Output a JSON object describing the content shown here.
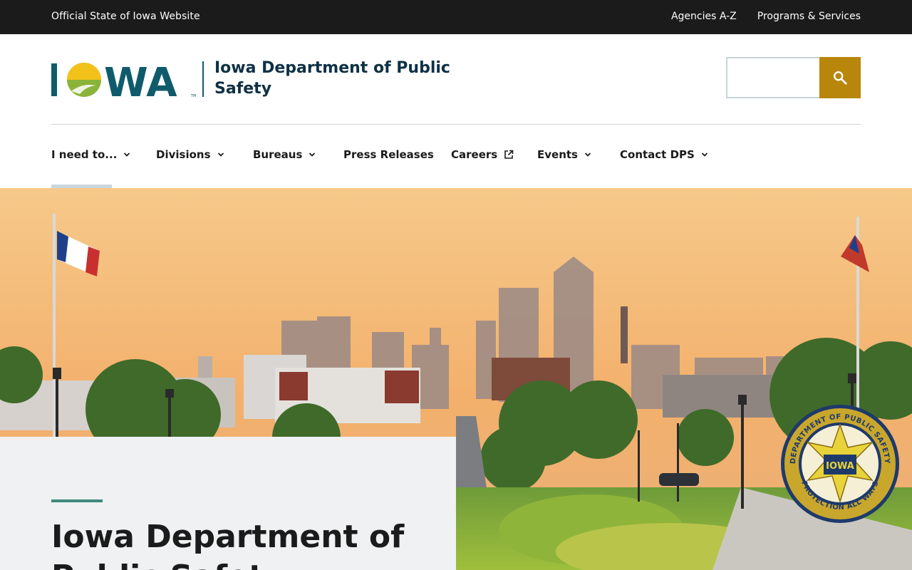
{
  "utility_bar": {
    "official_text": "Official State of Iowa Website",
    "links": [
      "Agencies A-Z",
      "Programs & Services"
    ]
  },
  "header": {
    "logo_text": "IOWA",
    "site_name": "Iowa Department of Public Safety",
    "search": {
      "placeholder": "",
      "value": "",
      "button_icon": "search-icon"
    }
  },
  "nav": {
    "items": [
      {
        "label": "I need to...",
        "icon": "chevron-down-icon"
      },
      {
        "label": "Divisions",
        "icon": "chevron-down-icon"
      },
      {
        "label": "Bureaus",
        "icon": "chevron-down-icon"
      },
      {
        "label": "Press Releases",
        "icon": ""
      },
      {
        "label": "Careers",
        "icon": "external-link-icon"
      },
      {
        "label": "Events",
        "icon": "chevron-down-icon"
      },
      {
        "label": "Contact DPS",
        "icon": "chevron-down-icon"
      }
    ]
  },
  "hero": {
    "title": "Iowa Department of Public Safety",
    "seal_text_top": "DEPARTMENT OF PUBLIC SAFETY",
    "seal_text_bottom": "PROTECTION ALL WAYS",
    "seal_center": "IOWA"
  },
  "colors": {
    "utility_bg": "#1b1b1b",
    "brand_teal": "#0f5b6b",
    "search_button": "#b8860b",
    "accent_green": "#3f8a7d",
    "card_bg": "#eff1f2"
  }
}
